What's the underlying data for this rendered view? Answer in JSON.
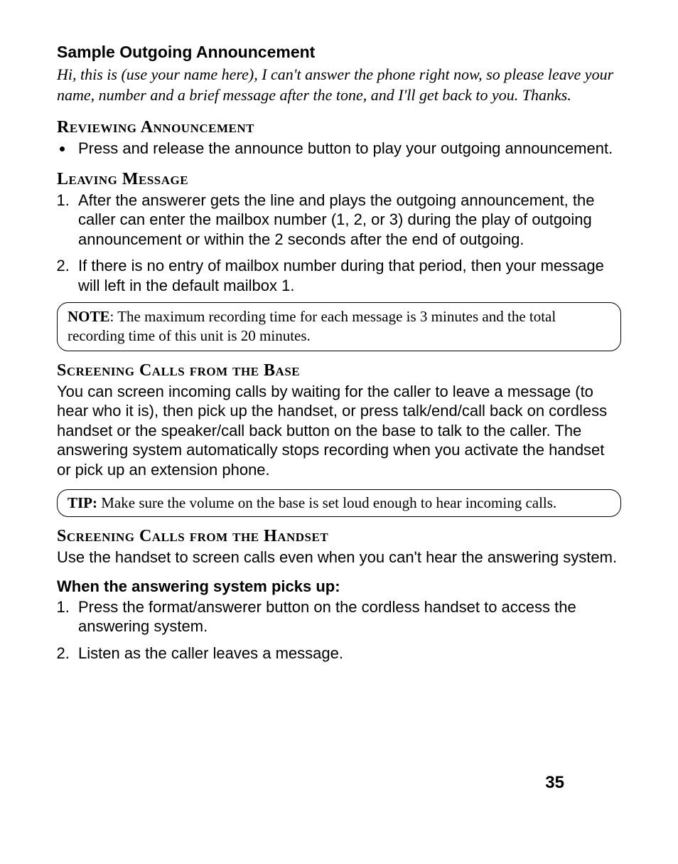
{
  "section1": {
    "heading": "Sample Outgoing Announcement",
    "sample_text": "Hi, this is (use your name here), I can't answer the phone right now, so please leave your name, number and a brief message after the tone, and I'll get back to you. Thanks."
  },
  "section2": {
    "heading": "Reviewing Announcement",
    "bullet1": "Press and release the announce button to play your outgoing announcement."
  },
  "section3": {
    "heading": "Leaving Message",
    "item1": "After the answerer gets the line and plays the outgoing announcement, the caller can enter the mailbox number (1, 2, or 3) during the play of outgoing announcement or within the 2 seconds after the end of outgoing.",
    "item2": "If there is no entry of mailbox number during that period, then your message will left in the default mailbox 1."
  },
  "note1": {
    "label": "NOTE",
    "text": ": The maximum recording time for each message is 3 minutes and the total recording time of this unit is 20 minutes."
  },
  "section4": {
    "heading": "Screening Calls from the Base",
    "para": "You can screen incoming calls by waiting for the caller to leave a message (to hear who it is), then pick up the handset, or press talk/end/call back on cordless handset or the speaker/call back button on the base to talk to the caller. The answering system automatically stops recording when you activate the handset or pick up an extension phone."
  },
  "tip1": {
    "label": "TIP:",
    "text": " Make sure the volume on the base is set loud enough to hear incoming calls."
  },
  "section5": {
    "heading": "Screening Calls from the Handset",
    "para": "Use the handset to screen calls even when you can't hear the answering system."
  },
  "section6": {
    "heading": "When the answering system picks up:",
    "item1": "Press the format/answerer button on the cordless handset to access the answering system.",
    "item2": "Listen as the caller leaves a message."
  },
  "page_number": "35"
}
